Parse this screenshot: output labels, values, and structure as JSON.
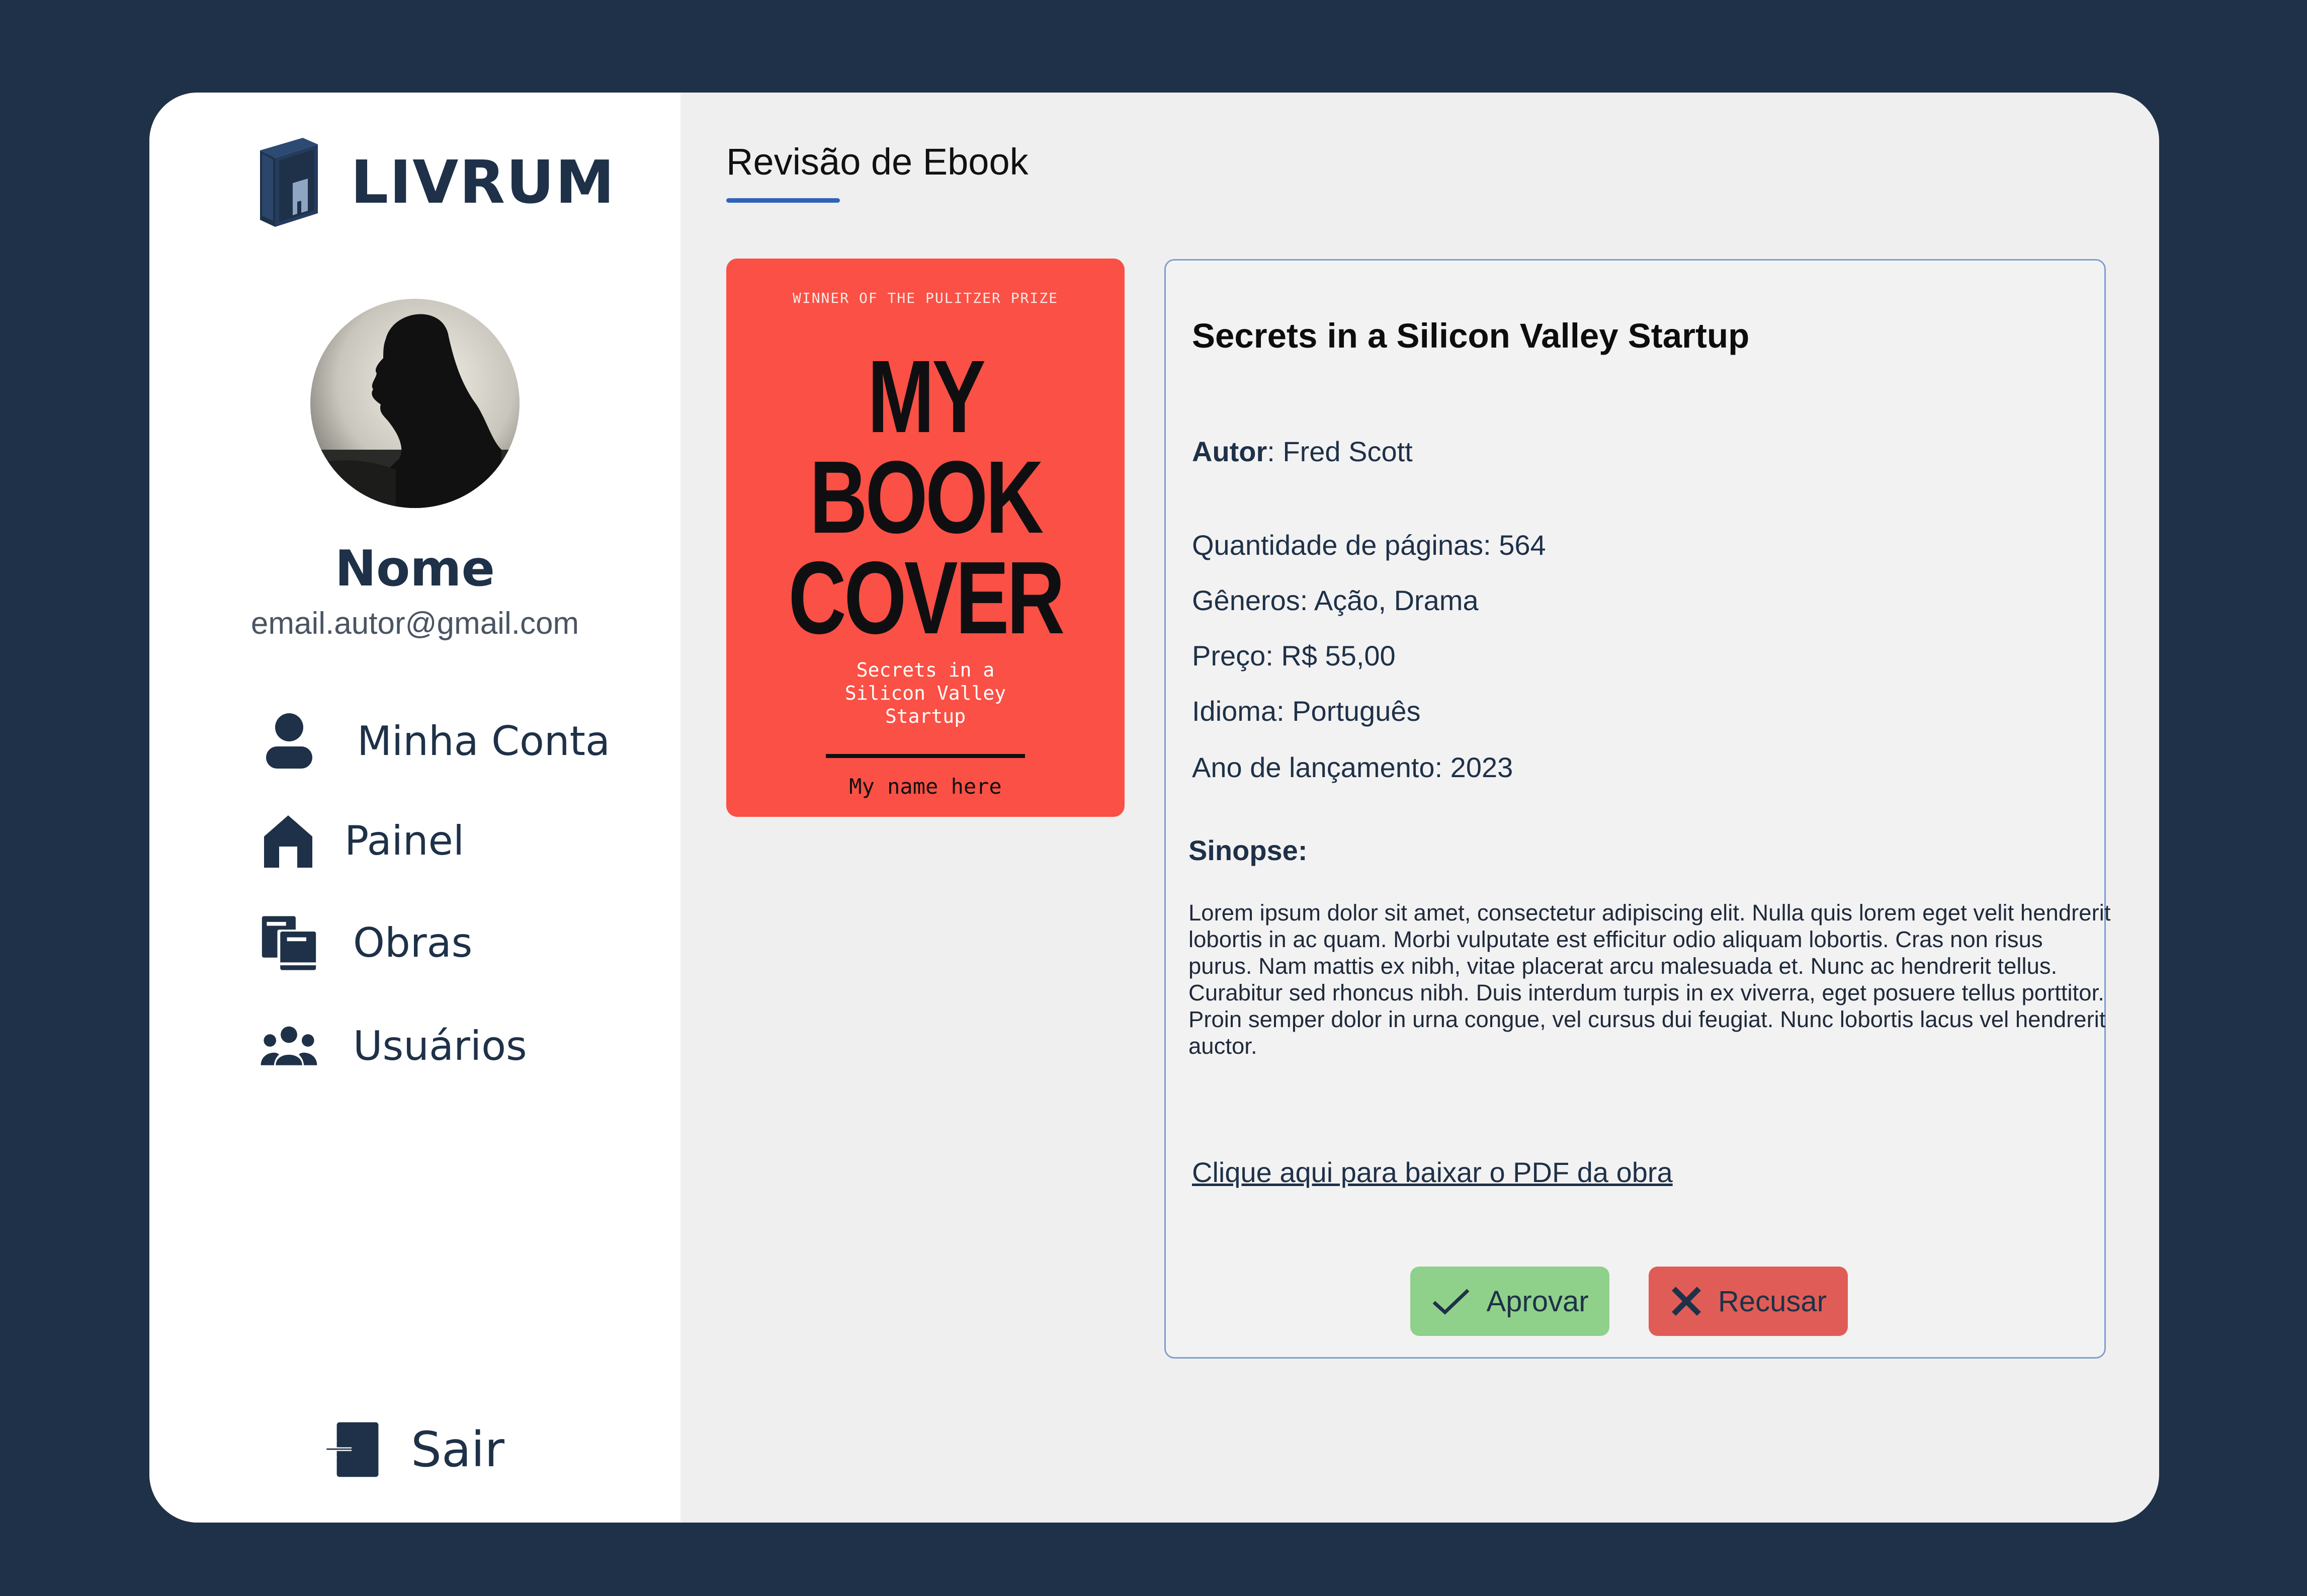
{
  "brand": {
    "name": "LIVRUM"
  },
  "profile": {
    "name": "Nome",
    "email": "email.autor@gmail.com"
  },
  "nav": {
    "account": "Minha Conta",
    "panel": "Painel",
    "works": "Obras",
    "users": "Usuários",
    "logout": "Sair"
  },
  "page": {
    "title": "Revisão de Ebook"
  },
  "cover": {
    "prize": "WINNER OF THE PULITZER PRIZE",
    "line1": "MY",
    "line2": "BOOK",
    "line3": "COVER",
    "subtitle_line1": "Secrets in a",
    "subtitle_line2": "Silicon Valley",
    "subtitle_line3": "Startup",
    "author": "My name here"
  },
  "book": {
    "title": "Secrets in a Silicon Valley Startup",
    "author_label": "Autor",
    "author_value": ": Fred Scott",
    "pages": "Quantidade de páginas: 564",
    "genres": "Gêneros: Ação, Drama",
    "price": "Preço: R$ 55,00",
    "language": "Idioma: Português",
    "year": "Ano de lançamento: 2023",
    "synopsis_label": "Sinopse:",
    "synopsis": "Lorem ipsum dolor sit amet, consectetur adipiscing elit. Nulla quis lorem eget velit hendrerit lobortis in ac quam. Morbi vulputate est efficitur odio aliquam lobortis. Cras non risus purus. Nam mattis ex nibh, vitae placerat arcu malesuada et. Nunc ac hendrerit tellus. Curabitur sed rhoncus nibh. Duis interdum turpis in ex viverra, eget posuere tellus porttitor. Proin semper dolor in urna congue, vel cursus dui feugiat. Nunc lobortis lacus vel hendrerit auctor.",
    "download_link": "Clique aqui para baixar o PDF da obra"
  },
  "actions": {
    "approve": "Aprovar",
    "reject": "Recusar"
  },
  "colors": {
    "background": "#1e3148",
    "accent": "#2e63b8",
    "approve": "#8fd18a",
    "reject": "#df5d56",
    "cover": "#fa5045"
  },
  "icons": {
    "logo": "book-logo-icon",
    "account": "user-icon",
    "panel": "home-icon",
    "works": "books-icon",
    "users": "users-group-icon",
    "logout": "logout-icon",
    "approve": "check-icon",
    "reject": "x-icon"
  }
}
